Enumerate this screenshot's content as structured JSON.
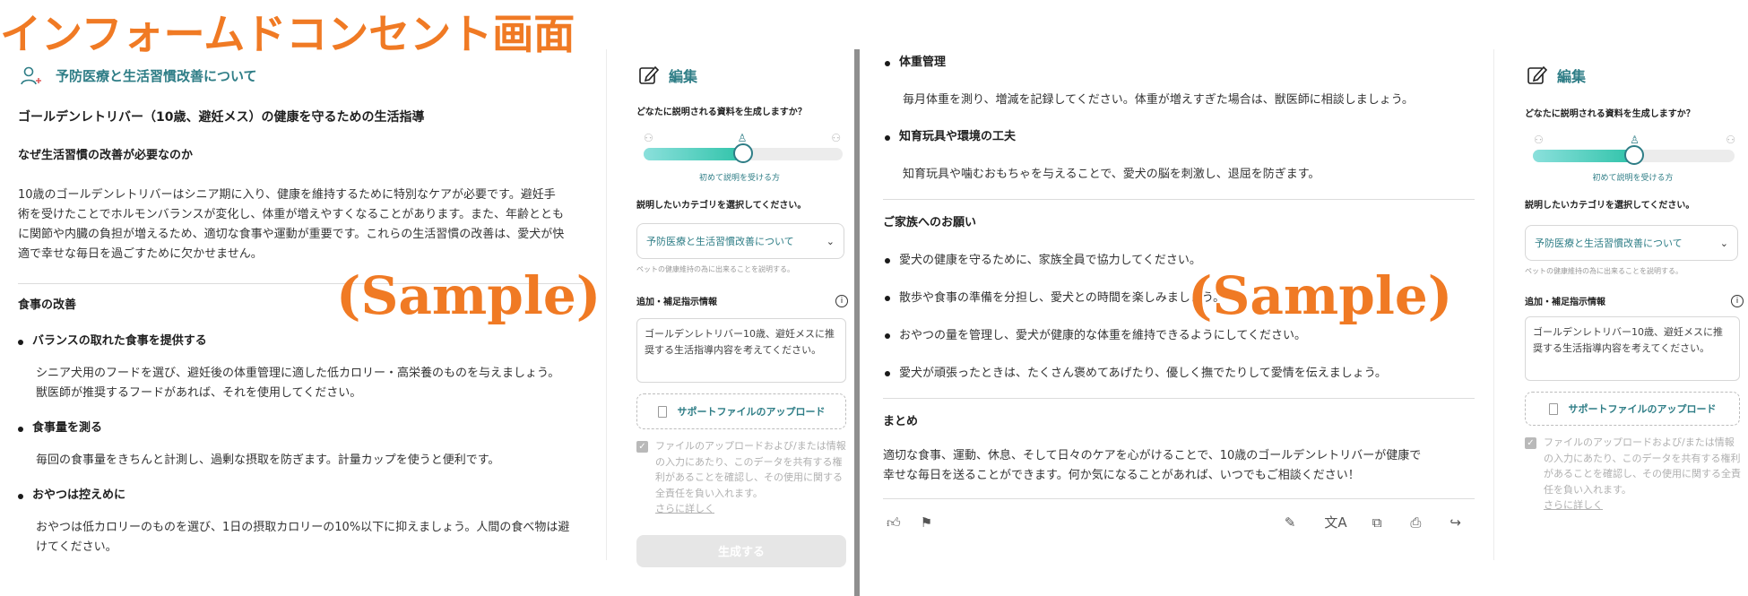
{
  "page_title": "インフォームドコンセント画面",
  "watermark": "(Sample)",
  "left_doc": {
    "topic_label": "予防医療と生活習慣改善について",
    "heading": "ゴールデンレトリバー（10歳、避妊メス）の健康を守るための生活指導",
    "why_heading": "なぜ生活習慣の改善が必要なのか",
    "why_lines": [
      "10歳のゴールデンレトリバーはシニア期に入り、健康を維持するために特別なケアが必要です。避妊手",
      "術を受けたことでホルモンバランスが変化し、体重が増えやすくなることがあります。また、年齢ととも",
      "に関節や内臓の負担が増えるため、適切な食事や運動が重要です。これらの生活習慣の改善は、愛犬が快",
      "適で幸せな毎日を過ごすために欠かせません。"
    ],
    "diet_heading": "食事の改善",
    "items": [
      {
        "title": "バランスの取れた食事を提供する",
        "lines": [
          "シニア犬用のフードを選び、避妊後の体重管理に適した低カロリー・高栄養のものを与えましょう。",
          "獣医師が推奨するフードがあれば、それを使用してください。"
        ]
      },
      {
        "title": "食事量を測る",
        "lines": [
          "毎回の食事量をきちんと計測し、過剰な摂取を防ぎます。計量カップを使うと便利です。"
        ]
      },
      {
        "title": "おやつは控えめに",
        "lines": [
          "おやつは低カロリーのものを選び、1日の摂取カロリーの10%以下に抑えましょう。人間の食べ物は避",
          "けてください。"
        ]
      }
    ]
  },
  "right_doc": {
    "items": [
      {
        "title": "体重管理",
        "line": "毎月体重を測り、増減を記録してください。体重が増えすぎた場合は、獣医師に相談しましょう。"
      },
      {
        "title": "知育玩具や環境の工夫",
        "line": "知育玩具や噛むおもちゃを与えることで、愛犬の脳を刺激し、退屈を防ぎます。"
      }
    ],
    "family_heading": "ご家族へのお願い",
    "family_items": [
      "愛犬の健康を守るために、家族全員で協力してください。",
      "散歩や食事の準備を分担し、愛犬との時間を楽しみましょう。",
      "おやつの量を管理し、愛犬が健康的な体重を維持できるようにしてください。",
      "愛犬が頑張ったときは、たくさん褒めてあげたり、優しく撫でたりして愛情を伝えましょう。"
    ],
    "summary_heading": "まとめ",
    "summary_lines": [
      "適切な食事、運動、休息、そして日々のケアを心がけることで、10歳のゴールデンレトリバーが健康で",
      "幸せな毎日を送ることができます。何か気になることがあれば、いつでもご相談ください！"
    ]
  },
  "panel": {
    "edit_label": "編集",
    "question": "どなたに説明される資料を生成しますか？",
    "slider_caption": "初めて説明を受ける方",
    "slider_value": 0.5,
    "category_question": "説明したいカテゴリを選択してください。",
    "category_value": "予防医療と生活習慣改善について",
    "category_hint": "ペットの健康維持の為に出来ることを説明する。",
    "extra_label": "追加・補足指示情報",
    "extra_text": "ゴールデンレトリバー10歳、避妊メスに推奨する生活指導内容を考えてください。",
    "upload_label": "サポートファイルのアップロード",
    "consent_text": "ファイルのアップロードおよび/または情報の入力にあたり、このデータを共有する権利があることを確認し、その使用に関する全責任を負い入れます。",
    "learn_more": "さらに詳しく",
    "generate_label": "生成する"
  },
  "colors": {
    "accent": "#2e7d86",
    "watermark": "#f07a24"
  },
  "icons": [
    "person-add-icon",
    "edit-icon",
    "info-icon",
    "chevron-down-icon",
    "file-icon",
    "thumbs-up-icon",
    "flag-icon",
    "pencil-icon",
    "translate-icon",
    "copy-icon",
    "print-icon",
    "share-icon"
  ]
}
